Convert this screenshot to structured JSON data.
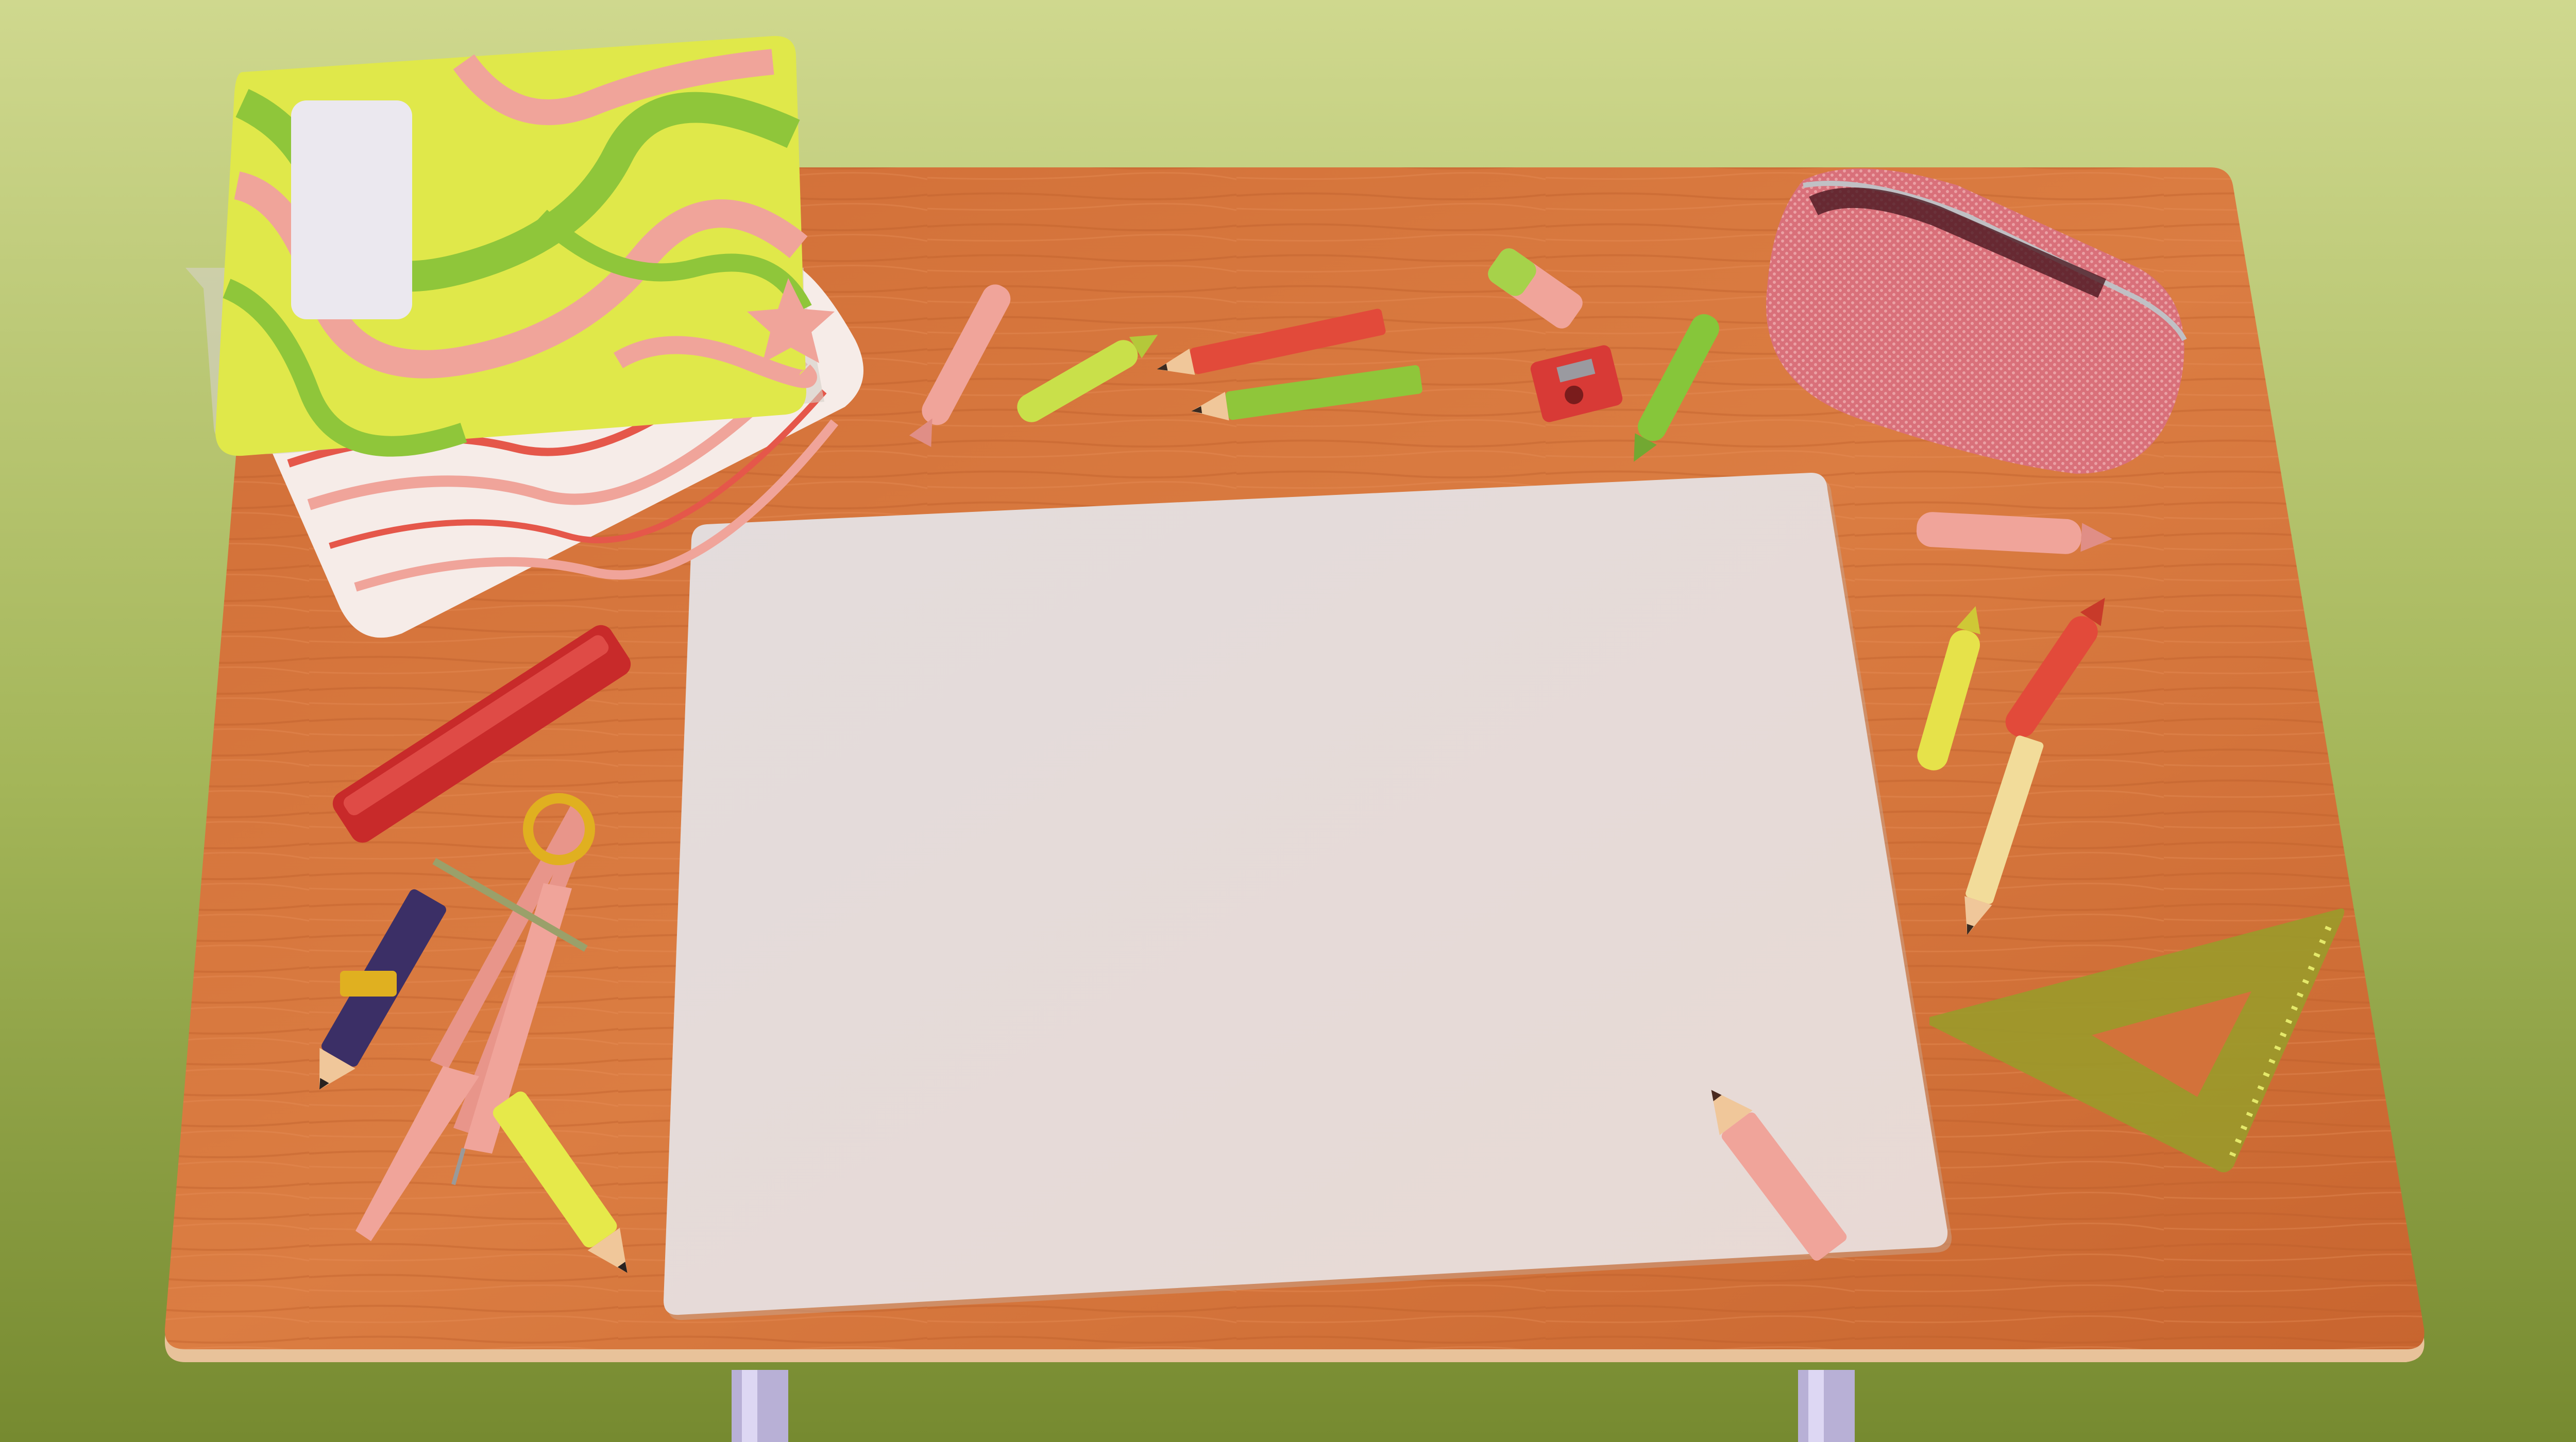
{
  "scene": {
    "background": {
      "top_color": "#cfd88e",
      "bottom_color": "#768a30"
    },
    "desk": {
      "wood_color": "#d3723a",
      "edge_color": "#e8c29a"
    },
    "paper": {
      "color": "#e6ddda",
      "state": "blank"
    },
    "objects": [
      "notebook-top",
      "notebook-bottom",
      "pencil-case",
      "crayon-pink",
      "crayon-lime",
      "pencil-red",
      "pencil-green",
      "eraser",
      "sharpener",
      "crayon-green",
      "crayon-pink-right",
      "crayon-yellow",
      "crayon-red",
      "pencil-cream",
      "ruler",
      "compass",
      "pencil-navy",
      "pencil-yellow",
      "pencil-pink-on-paper",
      "set-square"
    ],
    "colors": {
      "pink": "#f0a49a",
      "lime": "#c9e04a",
      "green": "#86c63a",
      "red": "#e24a3a",
      "cream": "#f2dc9a",
      "navy": "#3b2f66",
      "olive": "#9a9a2a",
      "case_pink": "#d9707a"
    }
  }
}
